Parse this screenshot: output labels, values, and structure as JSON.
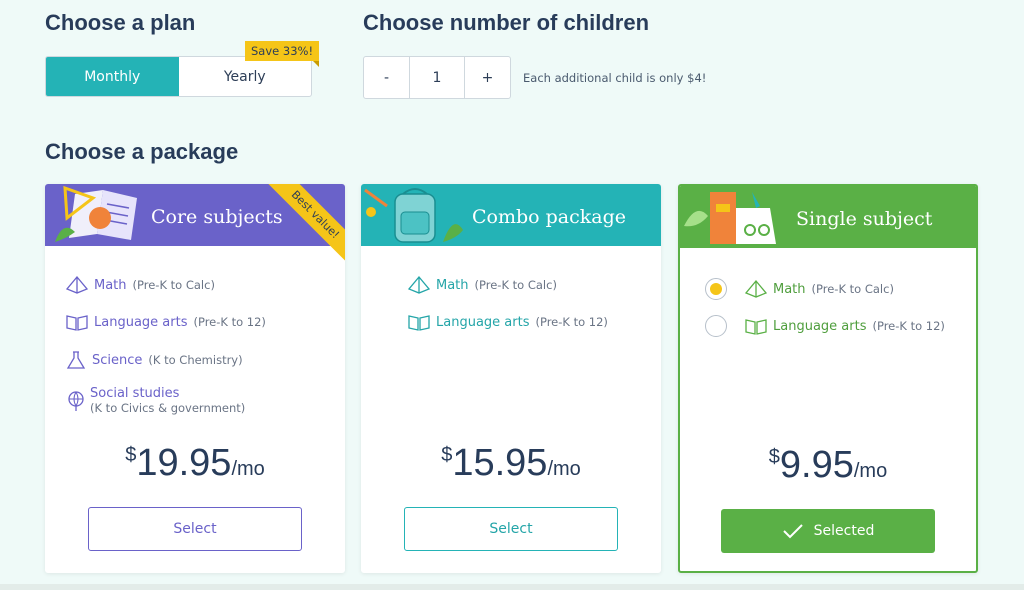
{
  "plan": {
    "heading": "Choose a plan",
    "options": [
      "Monthly",
      "Yearly"
    ],
    "selected": "Monthly",
    "save_badge": "Save 33%!"
  },
  "children": {
    "heading": "Choose number of children",
    "minus": "-",
    "plus": "+",
    "value": "1",
    "note": "Each additional child is only $4!"
  },
  "package": {
    "heading": "Choose a package",
    "cards": [
      {
        "title": "Core subjects",
        "ribbon": "Best value!",
        "color": "#6a62c9",
        "subjects": [
          {
            "name": "Math",
            "range": "(Pre-K to Calc)"
          },
          {
            "name": "Language arts",
            "range": "(Pre-K to 12)"
          },
          {
            "name": "Science",
            "range": "(K to Chemistry)"
          },
          {
            "name": "Social studies",
            "range": "(K to Civics & government)"
          }
        ],
        "currency": "$",
        "price": "19.95",
        "period": "/mo",
        "button": "Select"
      },
      {
        "title": "Combo package",
        "color": "#24b3b6",
        "subjects": [
          {
            "name": "Math",
            "range": "(Pre-K to Calc)"
          },
          {
            "name": "Language arts",
            "range": "(Pre-K to 12)"
          }
        ],
        "currency": "$",
        "price": "15.95",
        "period": "/mo",
        "button": "Select"
      },
      {
        "title": "Single subject",
        "color": "#5ab046",
        "subjects": [
          {
            "name": "Math",
            "range": "(Pre-K to Calc)",
            "selected": true
          },
          {
            "name": "Language arts",
            "range": "(Pre-K to 12)",
            "selected": false
          }
        ],
        "currency": "$",
        "price": "9.95",
        "period": "/mo",
        "button": "Selected"
      }
    ]
  },
  "icons": {
    "math": "pyramid-icon",
    "language_arts": "open-book-icon",
    "science": "flask-icon",
    "social_studies": "globe-icon",
    "checkmark": "checkmark-icon"
  }
}
